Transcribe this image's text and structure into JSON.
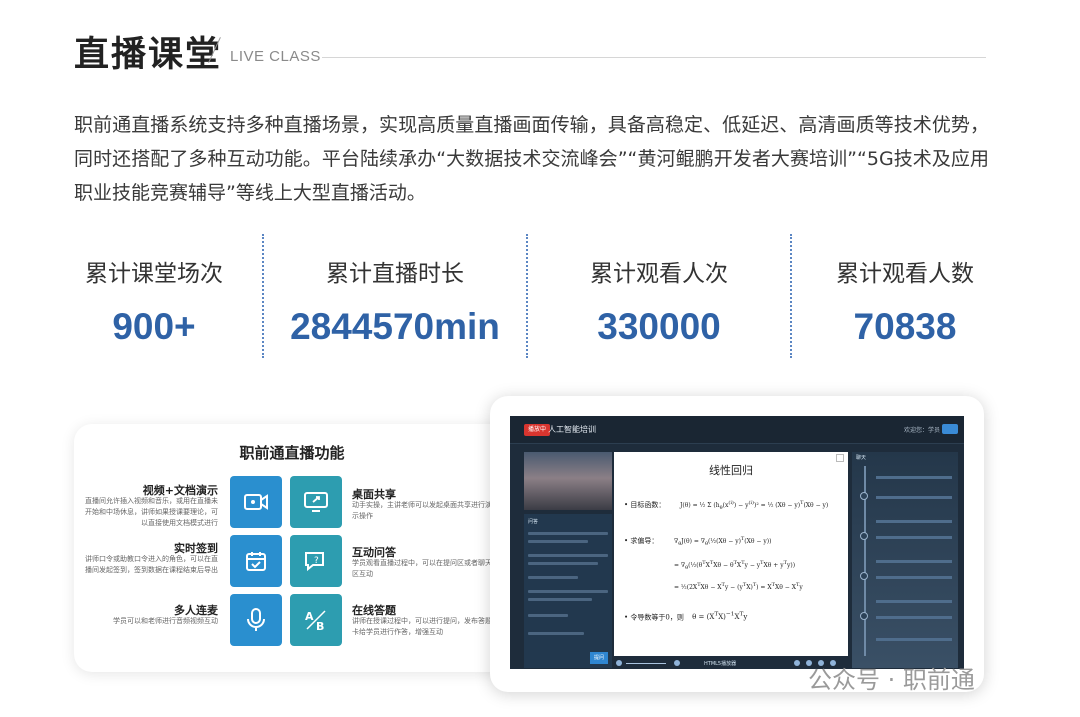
{
  "header": {
    "title": "直播课堂",
    "subtitle": "LIVE CLASS"
  },
  "intro": "职前通直播系统支持多种直播场景，实现高质量直播画面传输，具备高稳定、低延迟、高清画质等技术优势，同时还搭配了多种互动功能。平台陆续承办“大数据技术交流峰会”“黄河鲲鹏开发者大赛培训”“5G技术及应用职业技能竞赛辅导”等线上大型直播活动。",
  "stats": [
    {
      "label": "累计课堂场次",
      "value": "900+"
    },
    {
      "label": "累计直播时长",
      "value": "2844570min"
    },
    {
      "label": "累计观看人次",
      "value": "330000"
    },
    {
      "label": "累计观看人数",
      "value": "70838"
    }
  ],
  "features": {
    "title": "职前通直播功能",
    "items": [
      {
        "title": "视频+文档演示",
        "desc": "直播间允许插入视频和音乐，或用在直播未开始和中场休息，讲师如果授课要理论，可以直接使用文档模式进行",
        "icon": "video-icon"
      },
      {
        "title": "桌面共享",
        "desc": "动手实操，主讲老师可以发起桌面共享进行演示操作",
        "icon": "share-icon"
      },
      {
        "title": "实时签到",
        "desc": "讲师口令或助教口令进入的角色，可以在直播间发起签到，签到数据在课程结束后导出",
        "icon": "calendar-check-icon"
      },
      {
        "title": "互动问答",
        "desc": "学员观看直播过程中，可以在提问区或者聊天区互动",
        "icon": "chat-bubble-icon"
      },
      {
        "title": "多人连麦",
        "desc": "学员可以和老师进行音频视频互动",
        "icon": "microphone-icon"
      },
      {
        "title": "在线答题",
        "desc": "讲师在授课过程中，可以进行提问，发布答题卡给学员进行作答，增强互动",
        "icon": "answer-icon"
      }
    ]
  },
  "screenshot": {
    "badge": "播放中",
    "room_title": "人工智能培训",
    "welcome": "欢迎您：学员",
    "chat_tab": "问答",
    "send": "提问",
    "doc_title": "线性回归",
    "doc_items": [
      "目标函数：",
      "求偏导：",
      "令导数等于0，则"
    ],
    "html5_label": "HTML5播放器",
    "panel_title": "聊天"
  },
  "watermark": "公众号 · 职前通",
  "colors": {
    "accent": "#2f62a6",
    "tile_blue": "#2a8fcf",
    "tile_teal": "#2d9db0",
    "divider": "#5b86c3"
  }
}
